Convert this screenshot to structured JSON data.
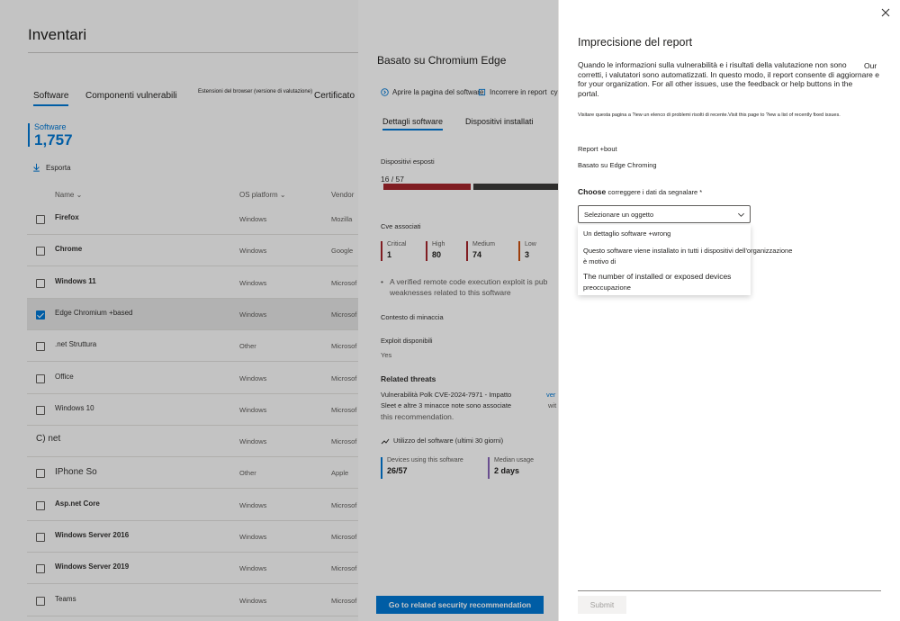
{
  "inventory": {
    "title": "Inventari",
    "tabs": [
      "Software",
      "Componenti vulnerabili",
      "Estensioni del browser (versione di valutazione)",
      "Certificato"
    ],
    "count_label": "Software",
    "count_value": "1,757",
    "export_label": "Esporta",
    "columns": [
      "Name",
      "OS platform",
      "Vendor"
    ],
    "rows": [
      {
        "name": "Firefox",
        "os": "Windows",
        "vendor": "Mozilla",
        "checked": false
      },
      {
        "name": "Chrome",
        "os": "Windows",
        "vendor": "Google",
        "checked": false
      },
      {
        "name": "Windows 11",
        "os": "Windows",
        "vendor": "Microsof",
        "checked": false
      },
      {
        "name": "Edge Chromium +based",
        "os": "Windows",
        "vendor": "Microsof",
        "checked": true
      },
      {
        "name": ".net Struttura",
        "os": "Other",
        "vendor": "Microsof",
        "checked": false
      },
      {
        "name": "Office",
        "os": "Windows",
        "vendor": "Microsof",
        "checked": false
      },
      {
        "name": "Windows 10",
        "os": "Windows",
        "vendor": "Microsof",
        "checked": false
      },
      {
        "name": "C) net",
        "os": "Windows",
        "vendor": "Microsof",
        "checked": null
      },
      {
        "name": "IPhone So",
        "os": "Other",
        "vendor": "Apple",
        "checked": false
      },
      {
        "name": "Asp.net Core",
        "os": "Windows",
        "vendor": "Microsof",
        "checked": false
      },
      {
        "name": "Windows Server 2016",
        "os": "Windows",
        "vendor": "Microsof",
        "checked": false
      },
      {
        "name": "Windows Server 2019",
        "os": "Windows",
        "vendor": "Microsof",
        "checked": false
      },
      {
        "name": "Teams",
        "os": "Windows",
        "vendor": "Microsof",
        "checked": false
      }
    ]
  },
  "detail": {
    "title": "Basato su Chromium Edge",
    "link_open": "Aprire la pagina del software",
    "link_report": "Incorrere in report",
    "link_report_tail": "cy",
    "tabs": [
      "Dettagli software",
      "Dispositivi installati"
    ],
    "exposed_label": "Dispositivi esposti",
    "exposed_value": "16 / 57",
    "exposed_fraction": 0.28,
    "cve_label": "Cve associati",
    "severities": [
      {
        "label": "Critical",
        "value": "1",
        "color": "#a4262c"
      },
      {
        "label": "High",
        "value": "80",
        "color": "#a4262c"
      },
      {
        "label": "Medium",
        "value": "74",
        "color": "#a4262c"
      },
      {
        "label": "Low",
        "value": "3",
        "color": "#ca5010"
      }
    ],
    "bullet_line1": "A verified remote code execution exploit is pub",
    "bullet_line2": "weaknesses related to this software",
    "threat_context": "Contesto di minaccia",
    "exploit_label": "Exploit disponibili",
    "exploit_value": "Yes",
    "related_threats": "Related threats",
    "threat1": "Vulnerabilità Polk CVE-2024-7971 - Impatto",
    "threat1_tail": "ver",
    "threat2": "Sleet e altre 3 minacce note sono associate",
    "threat2_tail": "wit",
    "threat3": "this recommendation.",
    "usage_title": "Utilizzo del software (ultimi 30 giorni)",
    "devices_using_label": "Devices using this software",
    "devices_using_value": "26/57",
    "median_label": "Median usage",
    "median_value": "2 days",
    "primary_button": "Go to related security recommendation"
  },
  "report": {
    "title": "Imprecisione del report",
    "desc_line1": "Quando le informazioni sulla vulnerabilità e i risultati della valutazione non sono",
    "desc_our": "Our",
    "desc_line2": "corretti, i valutatori sono automatizzati. In questo modo, il report consente di aggiornare e",
    "desc_line3": "for your organization. For all other issues, use the feedback or help buttons in the",
    "desc_line4": "portal.",
    "small_note": "Visitare questa pagina a ?iew un elenco di problemi risolti di recente.Visit this page to ?iew a list of recently fixed issues.",
    "report_about_label": "Report +bout",
    "report_about_value": "Basato su Edge Chroming",
    "choose_bold": "Choose",
    "choose_rest": "correggere i dati da segnalare *",
    "dropdown_value": "Selezionare un oggetto",
    "options": [
      "Un dettaglio software +wrong",
      "Questo software viene installato in tutti i dispositivi dell'organizzazione",
      "è motivo di",
      "The number of installed or exposed devices",
      "preoccupazione"
    ],
    "submit": "Submit"
  },
  "colors": {
    "accent": "#0078d4",
    "critical": "#a4262c",
    "low": "#ca5010"
  }
}
